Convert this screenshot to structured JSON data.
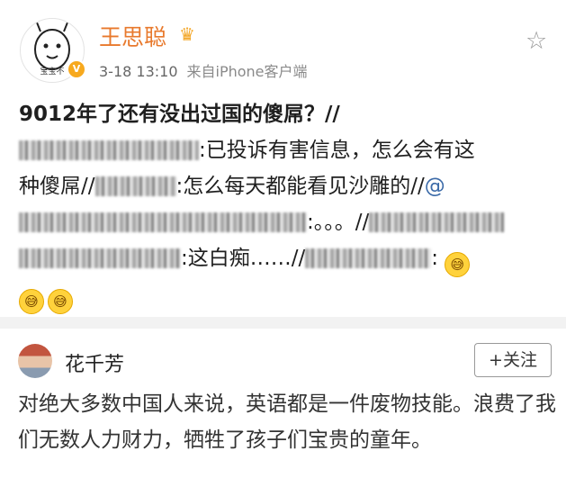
{
  "post": {
    "username": "王思聪",
    "avatar_caption": "宝宝不",
    "vip_badge": "V",
    "crown_icon": "crown-icon",
    "timestamp": "3-18 13:10",
    "source": "来自iPhone客户端",
    "content": {
      "line1": "9012年了还有没出过国的傻屌？//",
      "seg2": ":已投诉有害信息，怎么会有这",
      "seg3a": "种傻屌//",
      "seg3b": ":怎么每天都能看见沙雕的//",
      "at": "@",
      "seg4": ":。。。//",
      "seg5a": ":这白痴……//",
      "seg5b": ":",
      "emoji": "😅"
    }
  },
  "comment": {
    "username": "花千芳",
    "follow_label": "+关注",
    "text": "对绝大多数中国人来说，英语都是一件废物技能。浪费了我们无数人力财力，牺牲了孩子们宝贵的童年。"
  }
}
